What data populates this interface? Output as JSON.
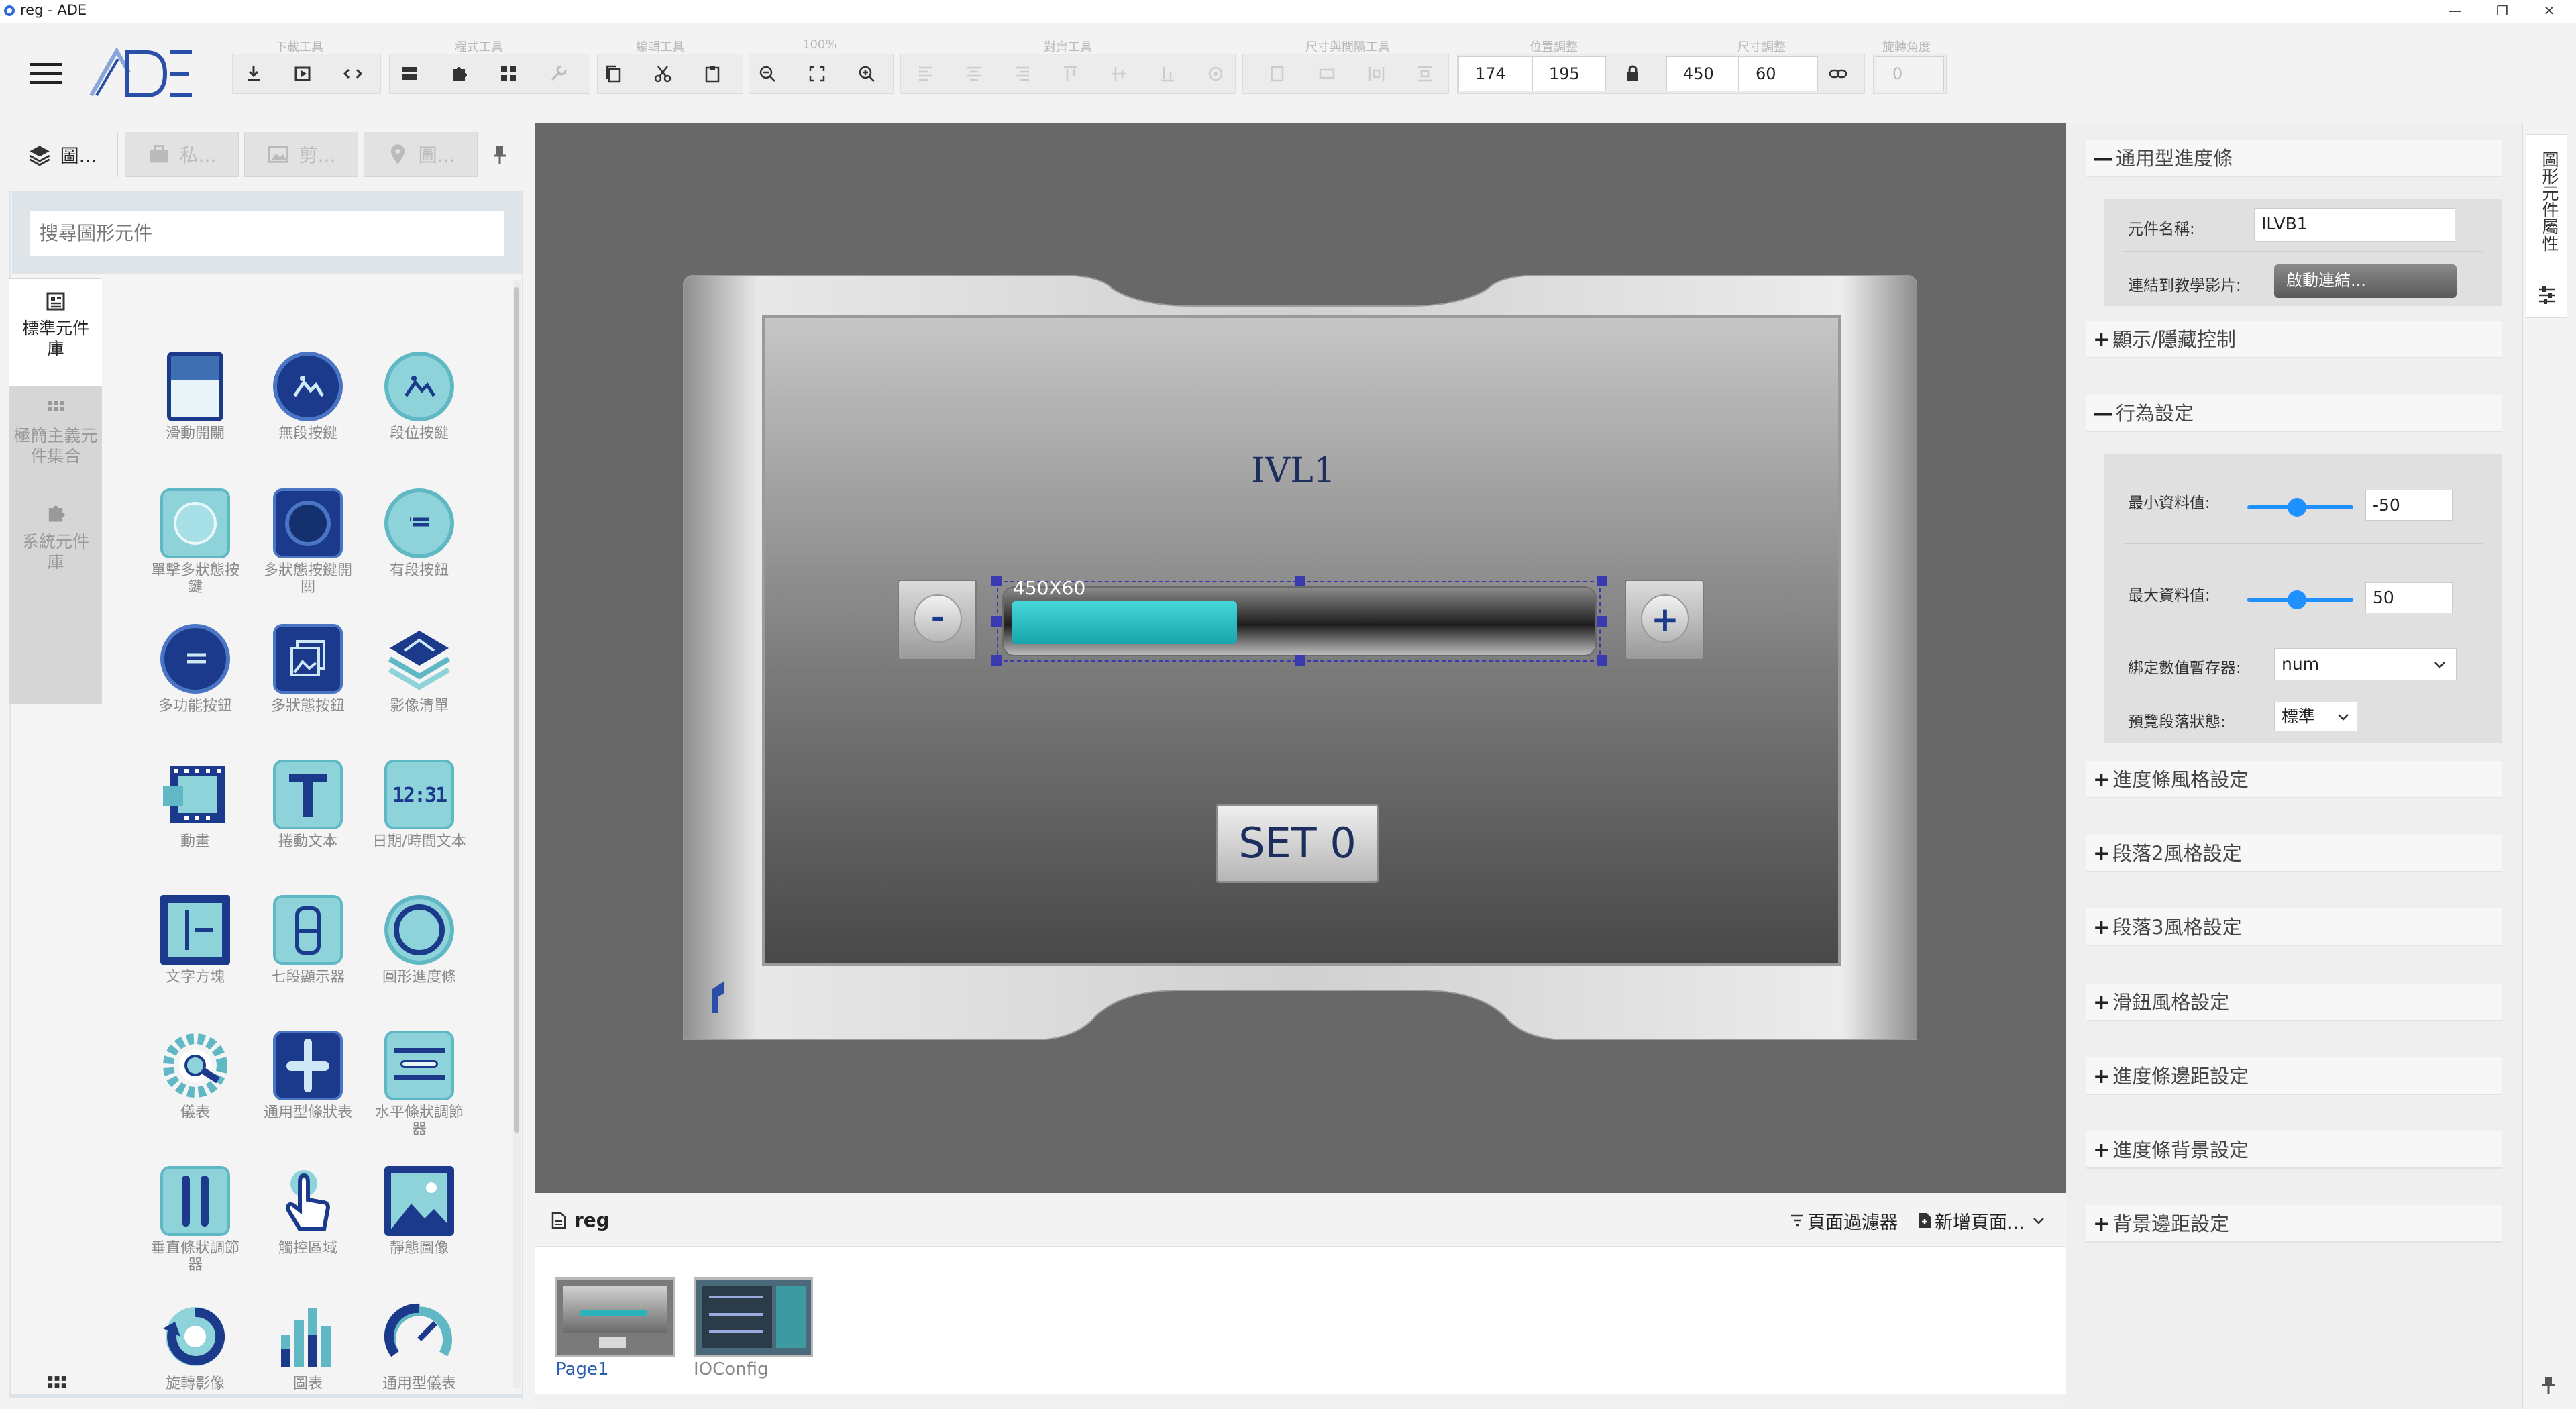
{
  "window": {
    "title": "reg - ADE",
    "minimize": "—",
    "restore": "❐",
    "close": "✕"
  },
  "toolbar": {
    "group_labels": [
      "下載工具",
      "程式工具",
      "編輯工具",
      "100%",
      "對齊工具",
      "尺寸與間隔工具",
      "位置調整",
      "尺寸調整",
      "旋轉角度"
    ],
    "pos_x": "174",
    "pos_y": "195",
    "width": "450",
    "height": "60",
    "rotation": "0"
  },
  "left": {
    "tabs": [
      "圖...",
      "私...",
      "剪...",
      "圖..."
    ],
    "search_placeholder": "搜尋圖形元件",
    "categories": [
      "標準元件庫",
      "極簡主義元件集合",
      "系統元件庫"
    ],
    "components": [
      "滑動開關",
      "無段按鍵",
      "段位按鍵",
      "單擊多狀態按鍵",
      "多狀態按鍵開關",
      "有段按鈕",
      "多功能按鈕",
      "多狀態按鈕",
      "影像清單",
      "動畫",
      "捲動文本",
      "日期/時間文本",
      "文字方塊",
      "七段顯示器",
      "圓形進度條",
      "儀表",
      "通用型條狀表",
      "水平條狀調節器",
      "垂直條狀調節器",
      "觸控區域",
      "靜態圖像",
      "旋轉影像",
      "圖表",
      "通用型儀表"
    ]
  },
  "canvas": {
    "label": "IVL1",
    "size_badge": "450X60",
    "minus": "-",
    "plus": "+",
    "set_button": "SET 0",
    "progress_fraction": 0.39
  },
  "pages": {
    "title": "reg",
    "filter": "頁面過濾器",
    "add_page": "新增頁面...",
    "items": [
      "Page1",
      "IOConfig"
    ]
  },
  "right": {
    "header": "通用型進度條",
    "name_label": "元件名稱:",
    "name_value": "ILVB1",
    "link_label": "連結到教學影片:",
    "link_button": "啟動連結...",
    "visibility": "顯示/隱藏控制",
    "behavior": "行為設定",
    "min_label": "最小資料值:",
    "min_value": "-50",
    "max_label": "最大資料值:",
    "max_value": "50",
    "register_label": "綁定數值暫存器:",
    "register_value": "num",
    "preview_label": "預覽段落狀態:",
    "preview_value": "標準",
    "sections": [
      "進度條風格設定",
      "段落2風格設定",
      "段落3風格設定",
      "滑鈕風格設定",
      "進度條邊距設定",
      "進度條背景設定",
      "背景邊距設定"
    ]
  },
  "side_tab": "圖形元件屬性",
  "colors": {
    "accent": "#1e90ff",
    "bar_fill": "#2ab3b8",
    "brand": "#1b3a8c"
  }
}
